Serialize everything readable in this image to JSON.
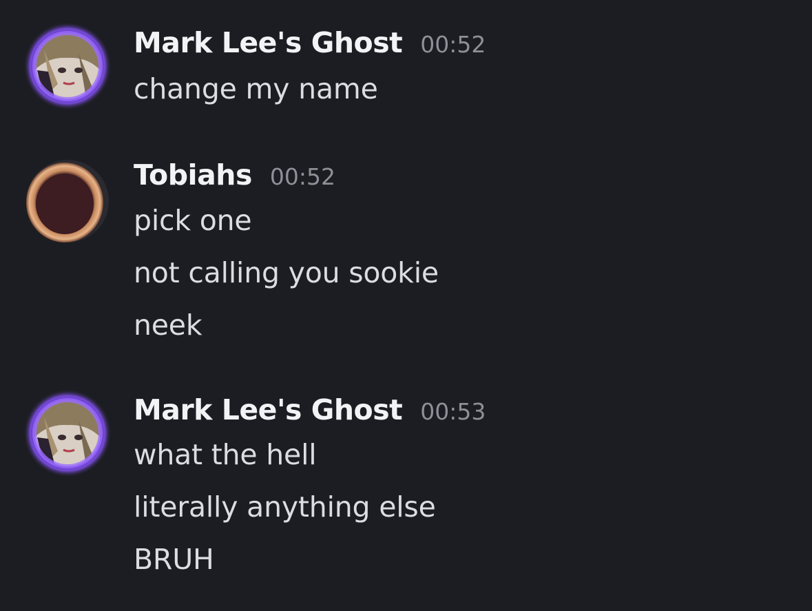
{
  "colors": {
    "background": "#1c1d22",
    "username": "#f2f3f5",
    "timestamp": "#8e9099",
    "message_text": "#dbdee1",
    "avatar_glow": "#7a3cff"
  },
  "messages": [
    {
      "author": "Mark Lee's Ghost",
      "timestamp": "00:52",
      "avatar_icon": "anime-avatar-purple-glow",
      "lines": [
        "change my name"
      ]
    },
    {
      "author": "Tobiahs",
      "timestamp": "00:52",
      "avatar_icon": "ring-avatar",
      "lines": [
        "pick one",
        "not calling you sookie",
        "neek"
      ]
    },
    {
      "author": "Mark Lee's Ghost",
      "timestamp": "00:53",
      "avatar_icon": "anime-avatar-purple-glow",
      "lines": [
        "what the hell",
        "literally anything else",
        "BRUH"
      ]
    }
  ]
}
